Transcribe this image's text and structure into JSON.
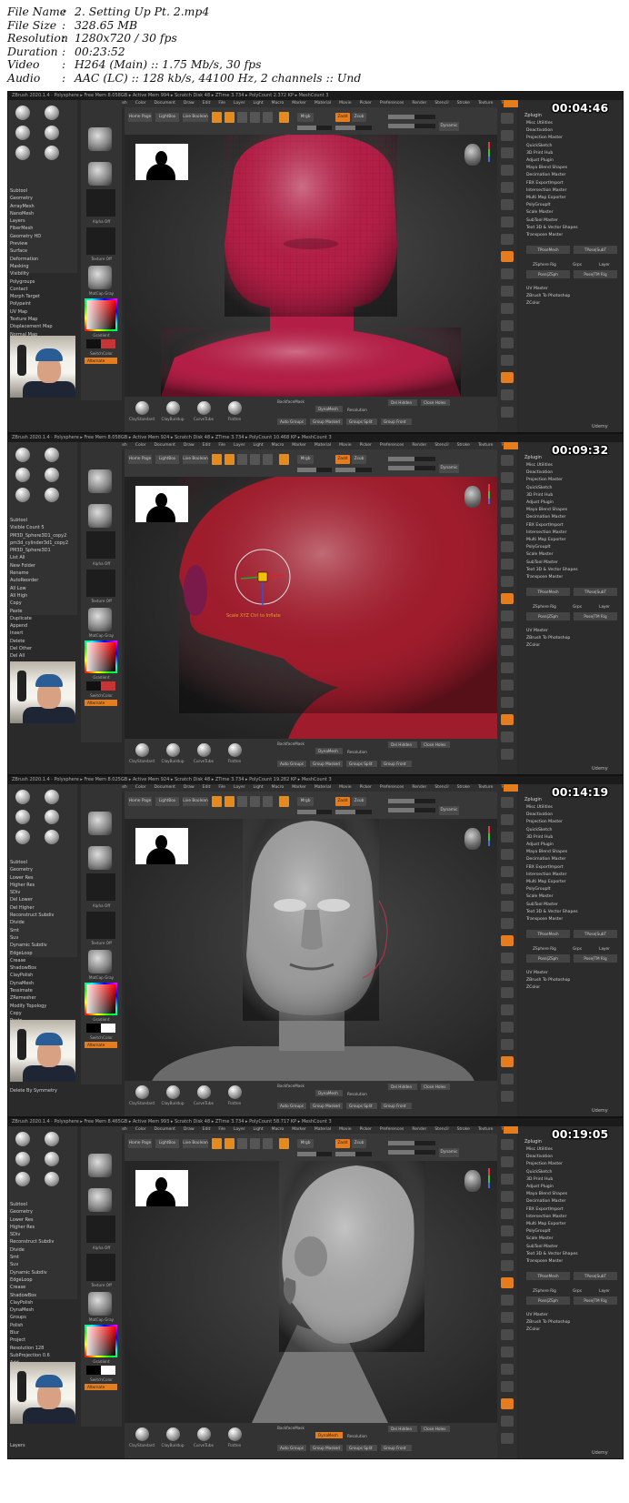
{
  "metadata": [
    {
      "key": "File Name",
      "value": "2. Setting Up Pt. 2.mp4"
    },
    {
      "key": "File Size",
      "value": "328.65 MB"
    },
    {
      "key": "Resolution",
      "value": "1280x720 / 30 fps"
    },
    {
      "key": "Duration",
      "value": "00:23:52"
    },
    {
      "key": "Video",
      "value": "H264 (Main) :: 1.75 Mb/s, 30 fps"
    },
    {
      "key": "Audio",
      "value": "AAC (LC) :: 128 kb/s, 44100 Hz, 2 channels :: Und"
    }
  ],
  "meta_separator": ":",
  "menu_items": [
    "Alpha",
    "Brush",
    "Color",
    "Document",
    "Draw",
    "Edit",
    "File",
    "Layer",
    "Light",
    "Macro",
    "Marker",
    "Material",
    "Movie",
    "Picker",
    "Preferences",
    "Render",
    "Stencil",
    "Stroke",
    "Texture",
    "Tool",
    "Transform",
    "Zplugin",
    "Zscript",
    "Help"
  ],
  "top_shelf": {
    "home": "Home Page",
    "lightbox": "LightBox",
    "live_boolean": "Live Boolean",
    "focal_shift": "Focal Shift",
    "draw_size": "Draw Size",
    "dynamic": "Dynamic",
    "zadd": "Zadd",
    "zsub": "Zsub",
    "zcut": "Zcut",
    "rgb": "Mrgb",
    "rgb_intensity": "Rgb Intensity",
    "z_intensity": "Z Intensity"
  },
  "plugin_panel": {
    "header": "Zplugin",
    "items": [
      "Misc Utilities",
      "Deactivation",
      "Projection Master",
      "QuickSketch",
      "3D Print Hub",
      "Adjust Plugin",
      "Maya Blend Shapes",
      "Decimation Master",
      "FBX ExportImport",
      "Intersection Master",
      "Multi Map Exporter",
      "PolyGroupIt",
      "Scale Master",
      "SubTool Master",
      "Text 3D & Vector Shapes",
      "Transpose Master"
    ],
    "row1": [
      "TPoseMesh",
      "TPose|SubT"
    ],
    "row2": [
      "ZSphere Rig",
      "Grps",
      "Layer"
    ],
    "row3": [
      "Pose|ZSph",
      "Pose|TM Rig"
    ],
    "items2": [
      "UV Master",
      "ZBrush To Photoshop",
      "ZColor"
    ]
  },
  "palette_labels": {
    "alpha": "Alpha Off",
    "texture": "Texture Off",
    "material": "MatCap Gray",
    "gradient": "Gradient",
    "switch": "SwitchColor",
    "alternate": "Alternate"
  },
  "bottom_bar": {
    "brushes": [
      "ClayStandard",
      "ClayBuildup",
      "CurveTube",
      "Flatten"
    ],
    "backface": "BackfaceMask",
    "dynamesh": "DynaMesh",
    "resolution": "Resolution",
    "del_hidden": "Del Hidden",
    "close_holes": "Close Holes",
    "auto_groups": "Auto Groups",
    "group_masked": "Group Masked",
    "groups_split": "Groups Split",
    "group_front": "Group Front",
    "watermark": "Udemy"
  },
  "frames": [
    {
      "timestamp": "00:04:46",
      "title": "ZBrush 2020.1.4 · Polysphere ▸ Free Mem 8.058GB ▸ Active Mem 994 ▸ Scratch Disk 48 ▸ ZTime 3.734 ▸ PolyCount 2.372 KP ▸ MeshCount 3",
      "left_menu": [
        "Subtool",
        "Geometry",
        "ArrayMesh",
        "NanoMesh",
        "Layers",
        "FiberMesh",
        "Geometry HD",
        "Preview",
        "Surface",
        "Deformation",
        "Masking",
        "Visibility",
        "Polygroups",
        "Contact",
        "Morph Target",
        "Polypaint",
        "UV Map",
        "Texture Map",
        "Displacement Map",
        "Normal Map",
        "Vector Displacement Map",
        "Display Properties"
      ],
      "mesh_color": "#b21e45"
    },
    {
      "timestamp": "00:09:32",
      "title": "ZBrush 2020.1.4 · Polysphere ▸ Free Mem 8.058GB ▸ Active Mem 924 ▸ Scratch Disk 48 ▸ ZTime 3.734 ▸ PolyCount 10.468 KP ▸ MeshCount 3",
      "left_menu": [
        "Subtool",
        "Visible Count 5",
        "PM3D_Sphere3D1_copy2",
        "pm3d_cylinder3d1_copy2",
        "PM3D_Sphere3D1",
        "List All",
        "New Folder",
        "Rename",
        "AutoReorder",
        "All Low",
        "All High",
        "Copy",
        "Paste",
        "Duplicate",
        "Append",
        "Insert",
        "Delete",
        "Del Other",
        "Del All"
      ],
      "gizmo_caption": "Scale XYZ Ctrl to Inflate",
      "mesh_color": "#9e1c2c"
    },
    {
      "timestamp": "00:14:19",
      "title": "ZBrush 2020.1.4 · Polysphere ▸ Free Mem 8.025GB ▸ Active Mem 924 ▸ Scratch Disk 48 ▸ ZTime 3.734 ▸ PolyCount 19.282 KP ▸ MeshCount 3",
      "left_menu": [
        "Subtool",
        "Geometry",
        "Lower Res",
        "Higher Res",
        "SDiv",
        "Del Lower",
        "Del Higher",
        "Reconstruct Subdiv",
        "Divide",
        "Smt",
        "Suv",
        "Dynamic Subdiv",
        "EdgeLoop",
        "Crease",
        "ShadowBox",
        "ClayPolish",
        "DynaMesh",
        "Tessimate",
        "ZRemesher",
        "Modify Topology",
        "Copy",
        "Paste",
        "Mirror And Weld"
      ],
      "bottom_left": "Delete By Symmetry",
      "mesh_color": "#9a9a9a"
    },
    {
      "timestamp": "00:19:05",
      "title": "ZBrush 2020.1.4 · Polysphere ▸ Free Mem 8.465GB ▸ Active Mem 993 ▸ Scratch Disk 48 ▸ ZTime 3.734 ▸ PolyCount 58.717 KP ▸ MeshCount 3",
      "left_menu": [
        "Subtool",
        "Geometry",
        "Lower Res",
        "Higher Res",
        "SDiv",
        "Reconstruct Subdiv",
        "Divide",
        "Smt",
        "Suv",
        "Dynamic Subdiv",
        "EdgeLoop",
        "Crease",
        "ShadowBox",
        "ClayPolish",
        "DynaMesh",
        "Groups",
        "Polish",
        "Blur",
        "Project",
        "Resolution 128",
        "SubProjection 0.6",
        "Add",
        "Sub",
        "And",
        "Create Shell",
        "Thickness 4"
      ],
      "bottom_left": "Layers",
      "mesh_color": "#a3a3a3"
    }
  ]
}
